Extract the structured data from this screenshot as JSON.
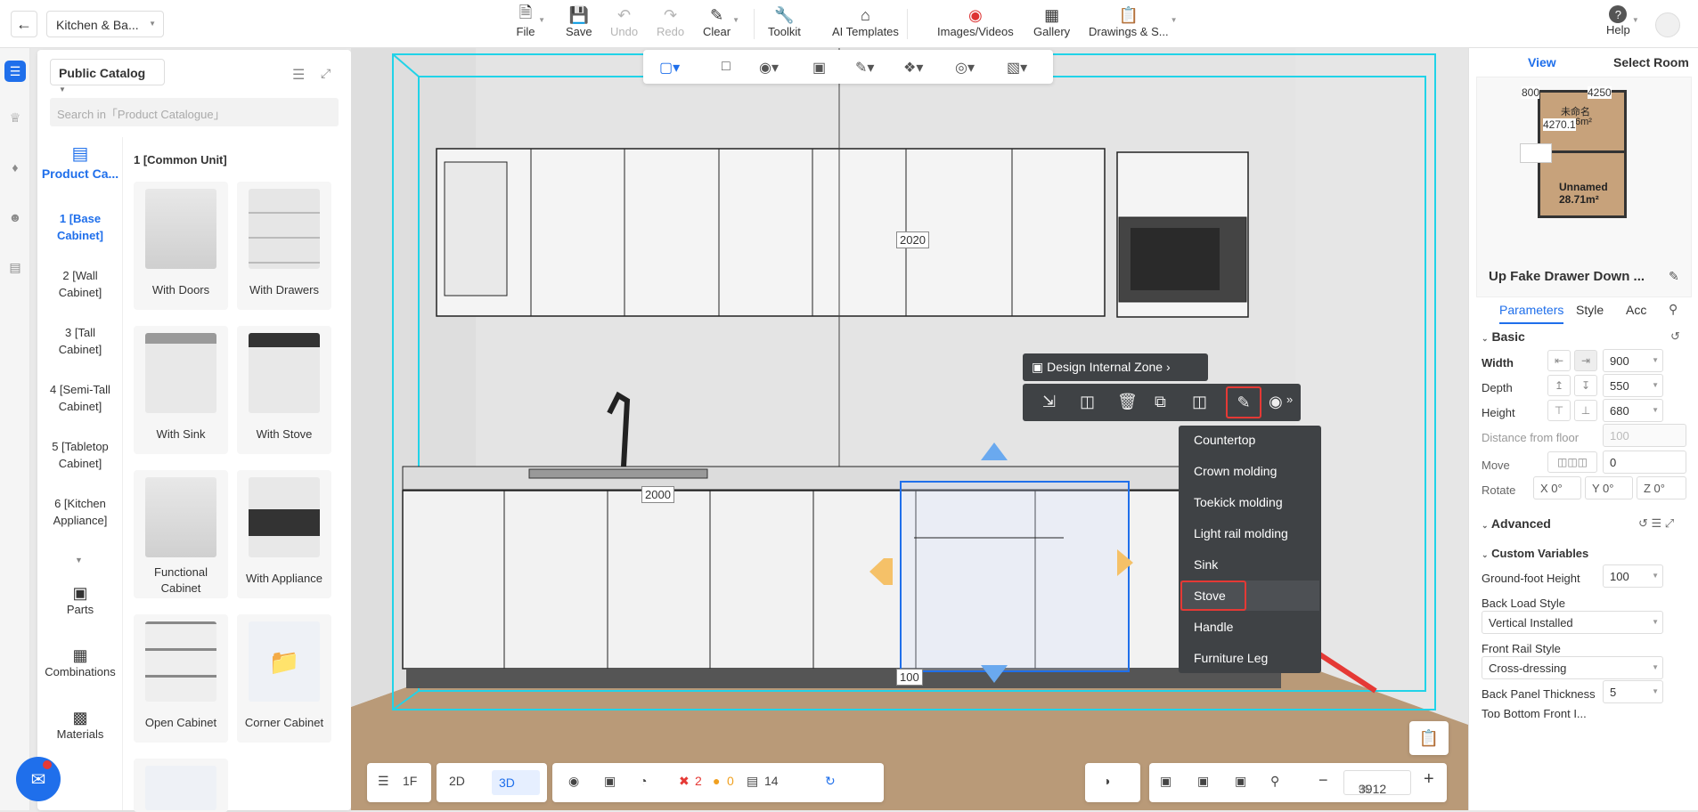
{
  "project": {
    "name": "Kitchen & Ba..."
  },
  "toolbar": [
    {
      "label": "File",
      "icon": "file-icon",
      "enabled": true
    },
    {
      "label": "Save",
      "icon": "save-icon",
      "enabled": true
    },
    {
      "label": "Undo",
      "icon": "undo-icon",
      "enabled": false
    },
    {
      "label": "Redo",
      "icon": "redo-icon",
      "enabled": false
    },
    {
      "label": "Clear",
      "icon": "eraser-icon",
      "enabled": true
    },
    {
      "label": "Toolkit",
      "icon": "wrench-icon",
      "enabled": true
    },
    {
      "label": "AI Templates",
      "icon": "ai-house-icon",
      "enabled": true
    },
    {
      "label": "Images/Videos",
      "icon": "camera-icon",
      "enabled": true
    },
    {
      "label": "Gallery",
      "icon": "gallery-icon",
      "enabled": true
    },
    {
      "label": "Drawings & S...",
      "icon": "drawings-icon",
      "enabled": true
    }
  ],
  "help": {
    "label": "Help"
  },
  "catalog": {
    "title": "Public Catalog",
    "search_placeholder": "Search in「Product Catalogue」",
    "side_active": "Product Ca...",
    "categories": [
      "1 [Base Cabinet]",
      "2 [Wall Cabinet]",
      "3 [Tall Cabinet]",
      "4 [Semi-Tall Cabinet]",
      "5 [Tabletop Cabinet]",
      "6 [Kitchen Appliance]"
    ],
    "bottom_tabs": [
      "Parts",
      "Combinations",
      "Materials"
    ],
    "section_title": "1 [Common Unit]",
    "products": [
      "With Doors",
      "With Drawers",
      "With Sink",
      "With Stove",
      "Functional Cabinet",
      "With Appliance",
      "Open Cabinet",
      "Corner Cabinet"
    ]
  },
  "viewport": {
    "dim_top": "2020",
    "dim_mid": "2000",
    "dim_bottom": "100",
    "design_zone": "Design Internal Zone",
    "context_menu": [
      "Countertop",
      "Crown molding",
      "Toekick molding",
      "Light rail molding",
      "Sink",
      "Stove",
      "Handle",
      "Furniture Leg"
    ],
    "selected_menu_item": "Stove"
  },
  "bottom": {
    "floor": "1F",
    "mode2d": "2D",
    "mode3d": "3D",
    "errors": "2",
    "warnings": "0",
    "count": "14",
    "zoom": "3912",
    "zoom_unit": "%"
  },
  "right_panel": {
    "tabs": [
      "View",
      "Select Room"
    ],
    "map_labels": {
      "dim_a": "800",
      "dim_b": "4250",
      "dim_c": "4270.1",
      "room_name": "Unnamed",
      "room_area": "28.71m²",
      "room2_fragment": "未命名",
      "room2_area_fragment": "6m²"
    },
    "title": "Up Fake Drawer Down ...",
    "prop_tabs": [
      "Parameters",
      "Style",
      "Acc"
    ],
    "basic": "Basic",
    "width": {
      "label": "Width",
      "value": "900"
    },
    "depth": {
      "label": "Depth",
      "value": "550"
    },
    "height": {
      "label": "Height",
      "value": "680"
    },
    "distance": {
      "label": "Distance from floor",
      "value": "100"
    },
    "move": {
      "label": "Move",
      "value": "0"
    },
    "rotate": {
      "label": "Rotate",
      "x": "X  0°",
      "y": "Y  0°",
      "z": "Z  0°"
    },
    "advanced": "Advanced",
    "custom_vars": "Custom Variables",
    "ground_foot": {
      "label": "Ground-foot Height",
      "value": "100"
    },
    "back_load": {
      "label": "Back Load Style",
      "value": "Vertical Installed"
    },
    "front_rail": {
      "label": "Front Rail Style",
      "value": "Cross-dressing"
    },
    "back_panel": {
      "label": "Back Panel Thickness",
      "value": "5"
    },
    "top_bottom": {
      "label": "Top Bottom Front I..."
    }
  },
  "colors": {
    "accent": "#1f6feb",
    "highlight_red": "#e53935",
    "dark_menu": "#3f4245",
    "cyan": "#21d3e8"
  }
}
